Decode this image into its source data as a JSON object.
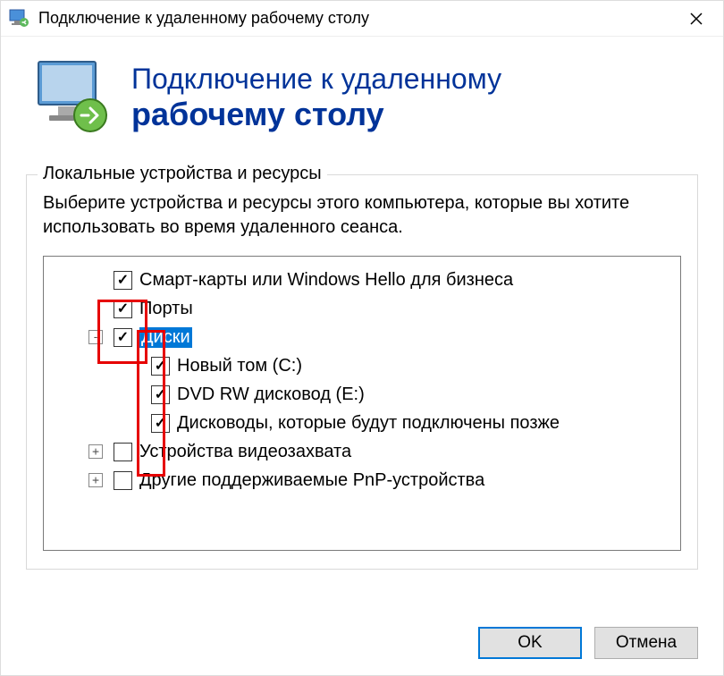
{
  "titlebar": {
    "title": "Подключение к удаленному рабочему столу"
  },
  "header": {
    "line1": "Подключение к удаленному",
    "line2": "рабочему столу"
  },
  "groupbox": {
    "title": "Локальные устройства и ресурсы",
    "description": "Выберите устройства и ресурсы этого компьютера, которые вы хотите использовать во время удаленного сеанса."
  },
  "tree": {
    "smartcards": {
      "label": "Смарт-карты или Windows Hello для бизнеса",
      "checked": true
    },
    "ports": {
      "label": "Порты",
      "checked": true
    },
    "drives": {
      "label": "Диски",
      "checked": true,
      "expanded": true,
      "children": {
        "c": {
          "label": "Новый том (C:)",
          "checked": true
        },
        "e": {
          "label": "DVD RW дисковод (E:)",
          "checked": true
        },
        "later": {
          "label": "Дисководы, которые будут подключены позже",
          "checked": true
        }
      }
    },
    "videocapture": {
      "label": "Устройства видеозахвата",
      "checked": false,
      "expanded": false
    },
    "pnp": {
      "label": "Другие поддерживаемые PnP-устройства",
      "checked": false,
      "expanded": false
    }
  },
  "footer": {
    "ok": "OK",
    "cancel": "Отмена"
  }
}
